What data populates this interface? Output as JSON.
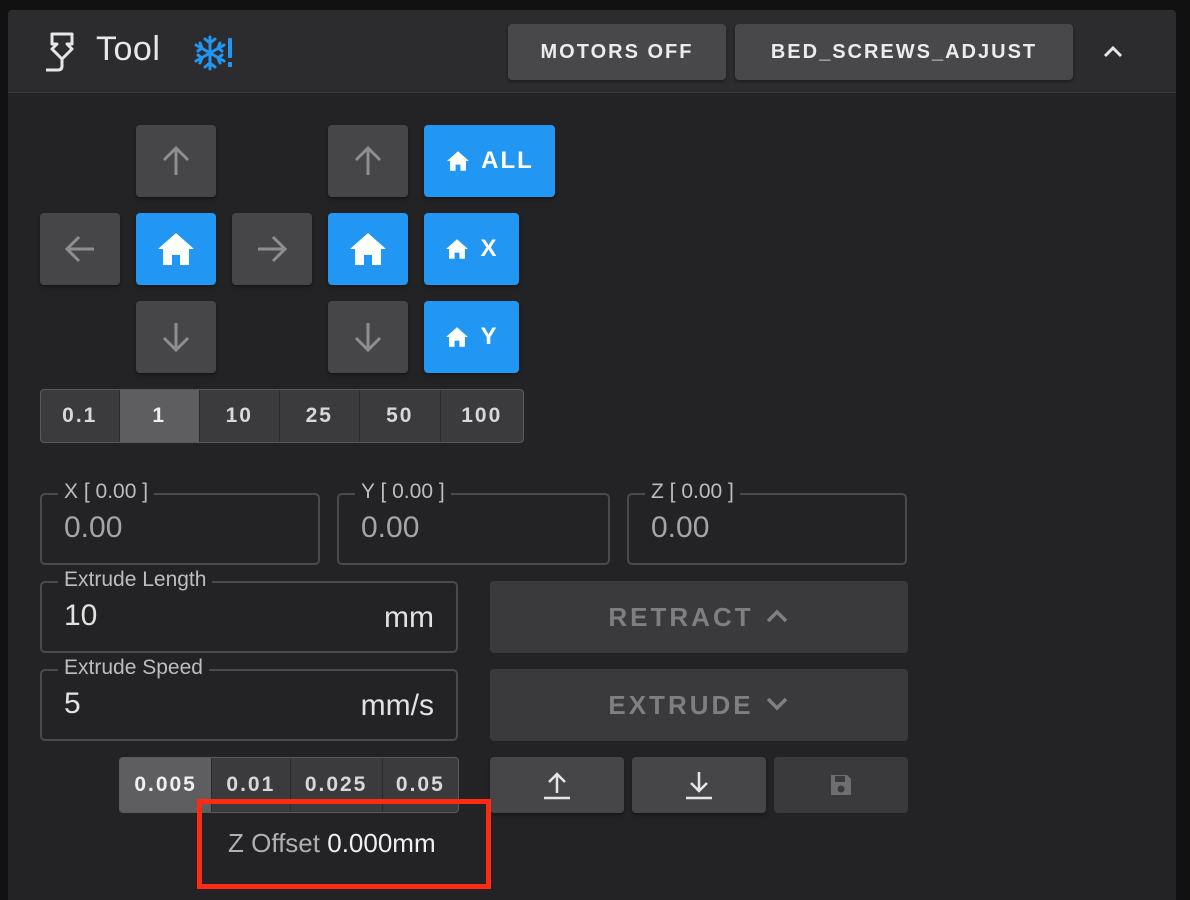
{
  "header": {
    "title": "Tool",
    "tool_icon": "printer-nozzle-icon",
    "status_icon": "snowflake-alert-icon",
    "motors_off_label": "MOTORS OFF",
    "bed_screws_label": "BED_SCREWS_ADJUST",
    "collapse_icon": "chevron-up-icon"
  },
  "jog": {
    "home_all_label": "ALL",
    "home_x_label": "X",
    "home_y_label": "Y"
  },
  "move_steps": {
    "options": [
      "0.1",
      "1",
      "10",
      "25",
      "50",
      "100"
    ],
    "selected": "1"
  },
  "positions": {
    "x_label": "X [ 0.00 ]",
    "x_placeholder": "0.00",
    "y_label": "Y [ 0.00 ]",
    "y_placeholder": "0.00",
    "z_label": "Z [ 0.00 ]",
    "z_placeholder": "0.00"
  },
  "extrude": {
    "length_label": "Extrude Length",
    "length_value": "10",
    "length_unit": "mm",
    "speed_label": "Extrude Speed",
    "speed_value": "5",
    "speed_unit": "mm/s",
    "retract_label": "RETRACT",
    "extrude_label": "EXTRUDE"
  },
  "zoffset": {
    "steps": [
      "0.005",
      "0.01",
      "0.025",
      "0.05"
    ],
    "selected": "0.005",
    "label": "Z Offset",
    "value": "0.000mm"
  },
  "colors": {
    "accent": "#2196f3",
    "highlight_box": "#ff2a12",
    "panel_bg": "#232325",
    "header_bg": "#2c2c2e",
    "button_gray": "#464649"
  }
}
